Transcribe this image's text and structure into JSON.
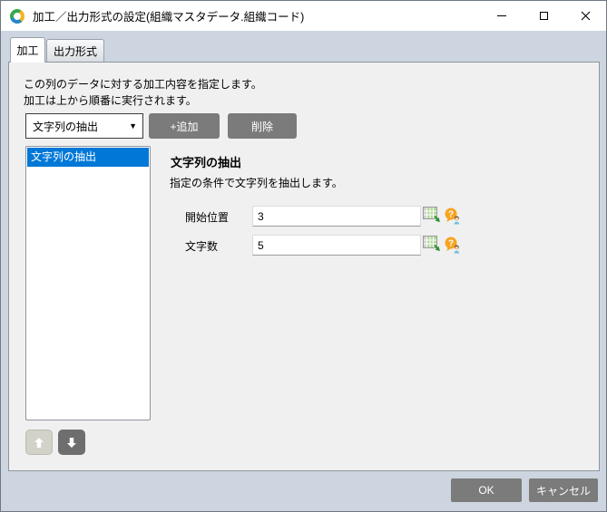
{
  "window": {
    "title": "加工／出力形式の設定(組織マスタデータ.組織コード)",
    "icon": "app-logo-icon",
    "controls": [
      "minimize",
      "maximize",
      "close"
    ]
  },
  "tabs": [
    {
      "label": "加工",
      "active": true
    },
    {
      "label": "出力形式",
      "active": false
    }
  ],
  "page": {
    "description_line1": "この列のデータに対する加工内容を指定します。",
    "description_line2": "加工は上から順番に実行されます。"
  },
  "toolbar": {
    "operation_dropdown": {
      "value": "文字列の抽出",
      "icon": "chevron-down-icon",
      "chevron": "▼"
    },
    "add_label": "+追加",
    "delete_label": "削除"
  },
  "operation_list": {
    "items": [
      {
        "label": "文字列の抽出",
        "selected": true
      }
    ]
  },
  "reorder": {
    "up_icon": "arrow-up-icon",
    "down_icon": "arrow-down-icon"
  },
  "detail": {
    "heading": "文字列の抽出",
    "description": "指定の条件で文字列を抽出します。",
    "fields": [
      {
        "label": "開始位置",
        "value": "3",
        "icons": [
          "grid-table-icon",
          "help-icon"
        ]
      },
      {
        "label": "文字数",
        "value": "5",
        "icons": [
          "grid-table-icon",
          "help-icon"
        ]
      }
    ]
  },
  "footer": {
    "ok_label": "OK",
    "cancel_label": "キャンセル"
  },
  "colors": {
    "selection_blue": "#0078d7",
    "button_gray": "#7b7b7b",
    "dialog_background": "#cdd5e0",
    "page_background": "#f0f0f0"
  }
}
